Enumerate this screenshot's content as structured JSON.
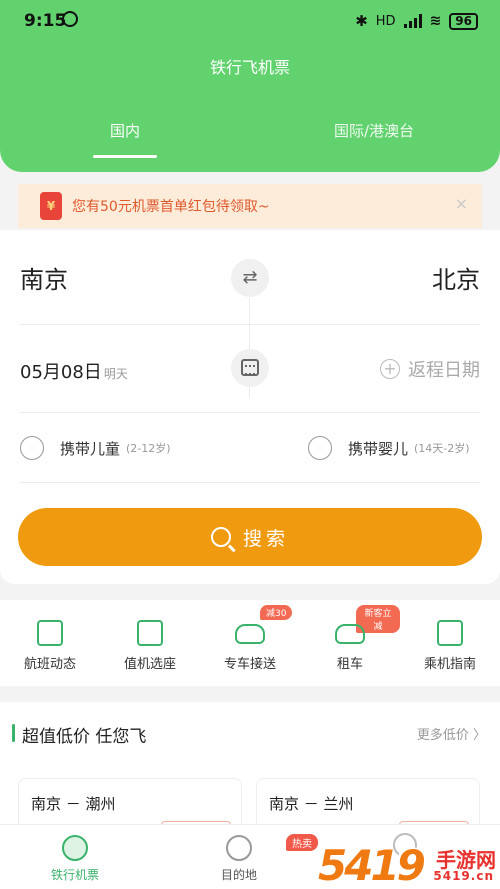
{
  "status_bar": {
    "time": "9:15",
    "network": "HD",
    "battery": "96"
  },
  "header": {
    "title": "铁行飞机票",
    "tabs": [
      {
        "label": "国内",
        "active": true
      },
      {
        "label": "国际/港澳台",
        "active": false
      }
    ]
  },
  "promo": {
    "icon": "¥",
    "text": "您有50元机票首单红包待领取~",
    "close": "×"
  },
  "booking": {
    "from_city": "南京",
    "to_city": "北京",
    "swap_icon": "⇄",
    "date": "05月08日",
    "date_sub": "明天",
    "return_label": "返程日期",
    "return_icon": "+",
    "options": [
      {
        "label": "携带儿童",
        "sub": "(2-12岁)"
      },
      {
        "label": "携带婴儿",
        "sub": "(14天-2岁)"
      }
    ],
    "search_label": "搜索"
  },
  "services": [
    {
      "label": "航班动态",
      "icon": "flight-status-icon",
      "badge": ""
    },
    {
      "label": "值机选座",
      "icon": "checkin-seat-icon",
      "badge": ""
    },
    {
      "label": "专车接送",
      "icon": "car-icon",
      "badge": "减30"
    },
    {
      "label": "租车",
      "icon": "rental-car-icon",
      "badge": "新客立减"
    },
    {
      "label": "乘机指南",
      "icon": "guide-icon",
      "badge": ""
    }
  ],
  "deals": {
    "title": "超值低价 任您飞",
    "more": "更多低价 〉",
    "routes": [
      "南京 － 潮州",
      "南京 － 兰州"
    ]
  },
  "bottom_nav": {
    "items": [
      {
        "label": "铁行机票",
        "active": true
      },
      {
        "label": "目的地",
        "active": false
      }
    ],
    "badge": "热卖"
  },
  "watermark": {
    "number": "5419",
    "site": "手游网",
    "url": "5419.cn"
  },
  "colors": {
    "primary_green": "#62d26f",
    "accent_orange": "#f09a0f",
    "promo_text": "#e05a2e"
  }
}
